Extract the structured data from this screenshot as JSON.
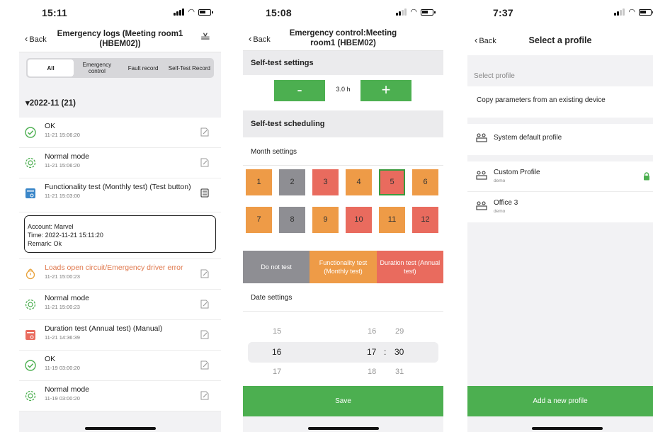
{
  "phone1": {
    "time": "15:11",
    "back_label": "Back",
    "title": "Emergency logs (Meeting room1 (HBEM02))",
    "tabs": [
      "All",
      "Emergency control",
      "Fault record",
      "Self-Test Record"
    ],
    "month_header": "▾2022-11  (21)",
    "logs": [
      {
        "title": "OK",
        "date": "11-21 15:06:20"
      },
      {
        "title": "Normal mode",
        "date": "11-21 15:06:20"
      },
      {
        "title": "Functionality test (Monthly test) (Test button)",
        "date": "11-21 15:03:00"
      },
      {
        "title": "Loads open circuit/Emergency driver error",
        "date": "11-21 15:00:23"
      },
      {
        "title": "Normal mode",
        "date": "11-21 15:00:23"
      },
      {
        "title": "Duration test (Annual test) (Manual)",
        "date": "11-21 14:36:39"
      },
      {
        "title": "OK",
        "date": "11-19 03:00:20"
      },
      {
        "title": "Normal mode",
        "date": "11-19 03:00:20"
      }
    ],
    "remark": {
      "account": "Account: Marvel",
      "time": "Time: 2022-11-21 15:11:20",
      "remark": "Remark: Ok"
    }
  },
  "phone2": {
    "time": "15:08",
    "back_label": "Back",
    "title": "Emergency control:Meeting room1 (HBEM02)",
    "selftest_header": "Self-test settings",
    "minus": "-",
    "plus": "+",
    "duration": "3.0 h",
    "scheduling_header": "Self-test scheduling",
    "month_settings": "Month settings",
    "months": [
      "1",
      "2",
      "3",
      "4",
      "5",
      "6",
      "7",
      "8",
      "9",
      "10",
      "11",
      "12"
    ],
    "month_states": [
      "func",
      "none",
      "dur",
      "func",
      "dur",
      "func",
      "func",
      "none",
      "func",
      "dur",
      "func",
      "dur"
    ],
    "colors": {
      "func": "#ee9b47",
      "none": "#8e8e93",
      "dur": "#e96b5e",
      "selected_border": "#3a9a3e",
      "green": "#4caf50"
    },
    "legend": [
      "Do not test",
      "Functionality test (Monthly test)",
      "Duration test (Annual test)"
    ],
    "date_settings": "Date settings",
    "picker_rows": [
      {
        "a": "15",
        "b": "16",
        "c": "29"
      },
      {
        "a": "16",
        "b": "17",
        "c": "30"
      },
      {
        "a": "17",
        "b": "18",
        "c": "31"
      }
    ],
    "picker_sep": ":",
    "save": "Save"
  },
  "phone3": {
    "time": "7:37",
    "back_label": "Back",
    "title": "Select a profile",
    "select_label": "Select profile",
    "copy_item": "Copy parameters from an existing device",
    "system_profile": "System default profile",
    "profiles": [
      {
        "name": "Custom Profile",
        "sub": "demo",
        "locked": true
      },
      {
        "name": "Office 3",
        "sub": "demo",
        "locked": false
      }
    ],
    "add": "Add a new profile"
  }
}
